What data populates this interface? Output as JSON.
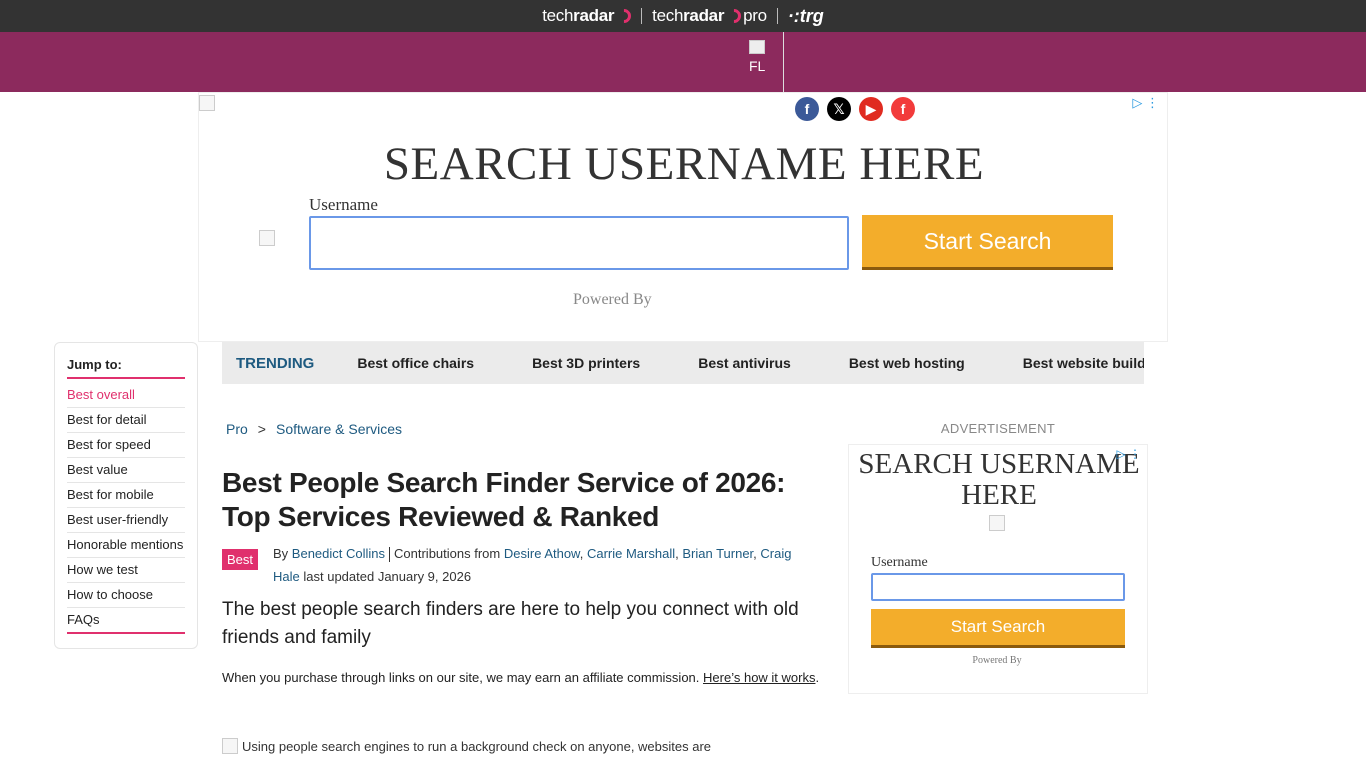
{
  "brandbar": {
    "brand1_a": "tech",
    "brand1_b": "radar",
    "brand2_a": "tech",
    "brand2_b": "radar",
    "brand2_c": "pro",
    "brand3": "·:trg"
  },
  "header": {
    "logo_alt": "FL"
  },
  "social": {
    "facebook": "f",
    "x": "𝕏",
    "youtube": "▶",
    "flipboard": "f"
  },
  "top_ad": {
    "title": "SEARCH USERNAME HERE",
    "label": "Username",
    "button": "Start Search",
    "powered": "Powered By",
    "adchoices": "▷ ⋮"
  },
  "jump": {
    "title": "Jump to:",
    "items": [
      {
        "label": "Best overall"
      },
      {
        "label": "Best for detail"
      },
      {
        "label": "Best for speed"
      },
      {
        "label": "Best value"
      },
      {
        "label": "Best for mobile"
      },
      {
        "label": "Best user-friendly"
      },
      {
        "label": "Honorable mentions"
      },
      {
        "label": "How we test"
      },
      {
        "label": "How to choose"
      },
      {
        "label": "FAQs"
      }
    ]
  },
  "trending": {
    "label": "TRENDING",
    "items": [
      {
        "label": "Best office chairs"
      },
      {
        "label": "Best 3D printers"
      },
      {
        "label": "Best antivirus"
      },
      {
        "label": "Best web hosting"
      },
      {
        "label": "Best website builder"
      }
    ]
  },
  "breadcrumb": {
    "first": "Pro",
    "sep": ">",
    "second": "Software & Services"
  },
  "article": {
    "headline": "Best People Search Finder Service of 2026: Top Services Reviewed & Ranked",
    "badge": "Best",
    "by": "By",
    "author": "Benedict Collins",
    "contrib": "Contributions from",
    "c1": "Desire Athow",
    "c2": "Carrie Marshall",
    "c3": "Brian Turner",
    "c4": "Craig Hale",
    "updated": "last updated January 9, 2026",
    "standfirst": "The best people search finders are here to help you connect with old friends and family",
    "affiliate": "When you purchase through links on our site, we may earn an affiliate commission.",
    "affiliate_link": "Here’s how it works",
    "overlap": "Using people search engines to run a background check on anyone, websites are"
  },
  "side_ad": {
    "label": "ADVERTISEMENT",
    "title": "SEARCH USERNAME HERE",
    "field_label": "Username",
    "button": "Start Search",
    "powered": "Powered By",
    "adchoices": "▷ ⋮"
  },
  "colors": {
    "brand_pink": "#e0306d",
    "header_purple": "#8c2a5d",
    "link_blue": "#1e5a80",
    "button_orange": "#f3ad2b"
  }
}
